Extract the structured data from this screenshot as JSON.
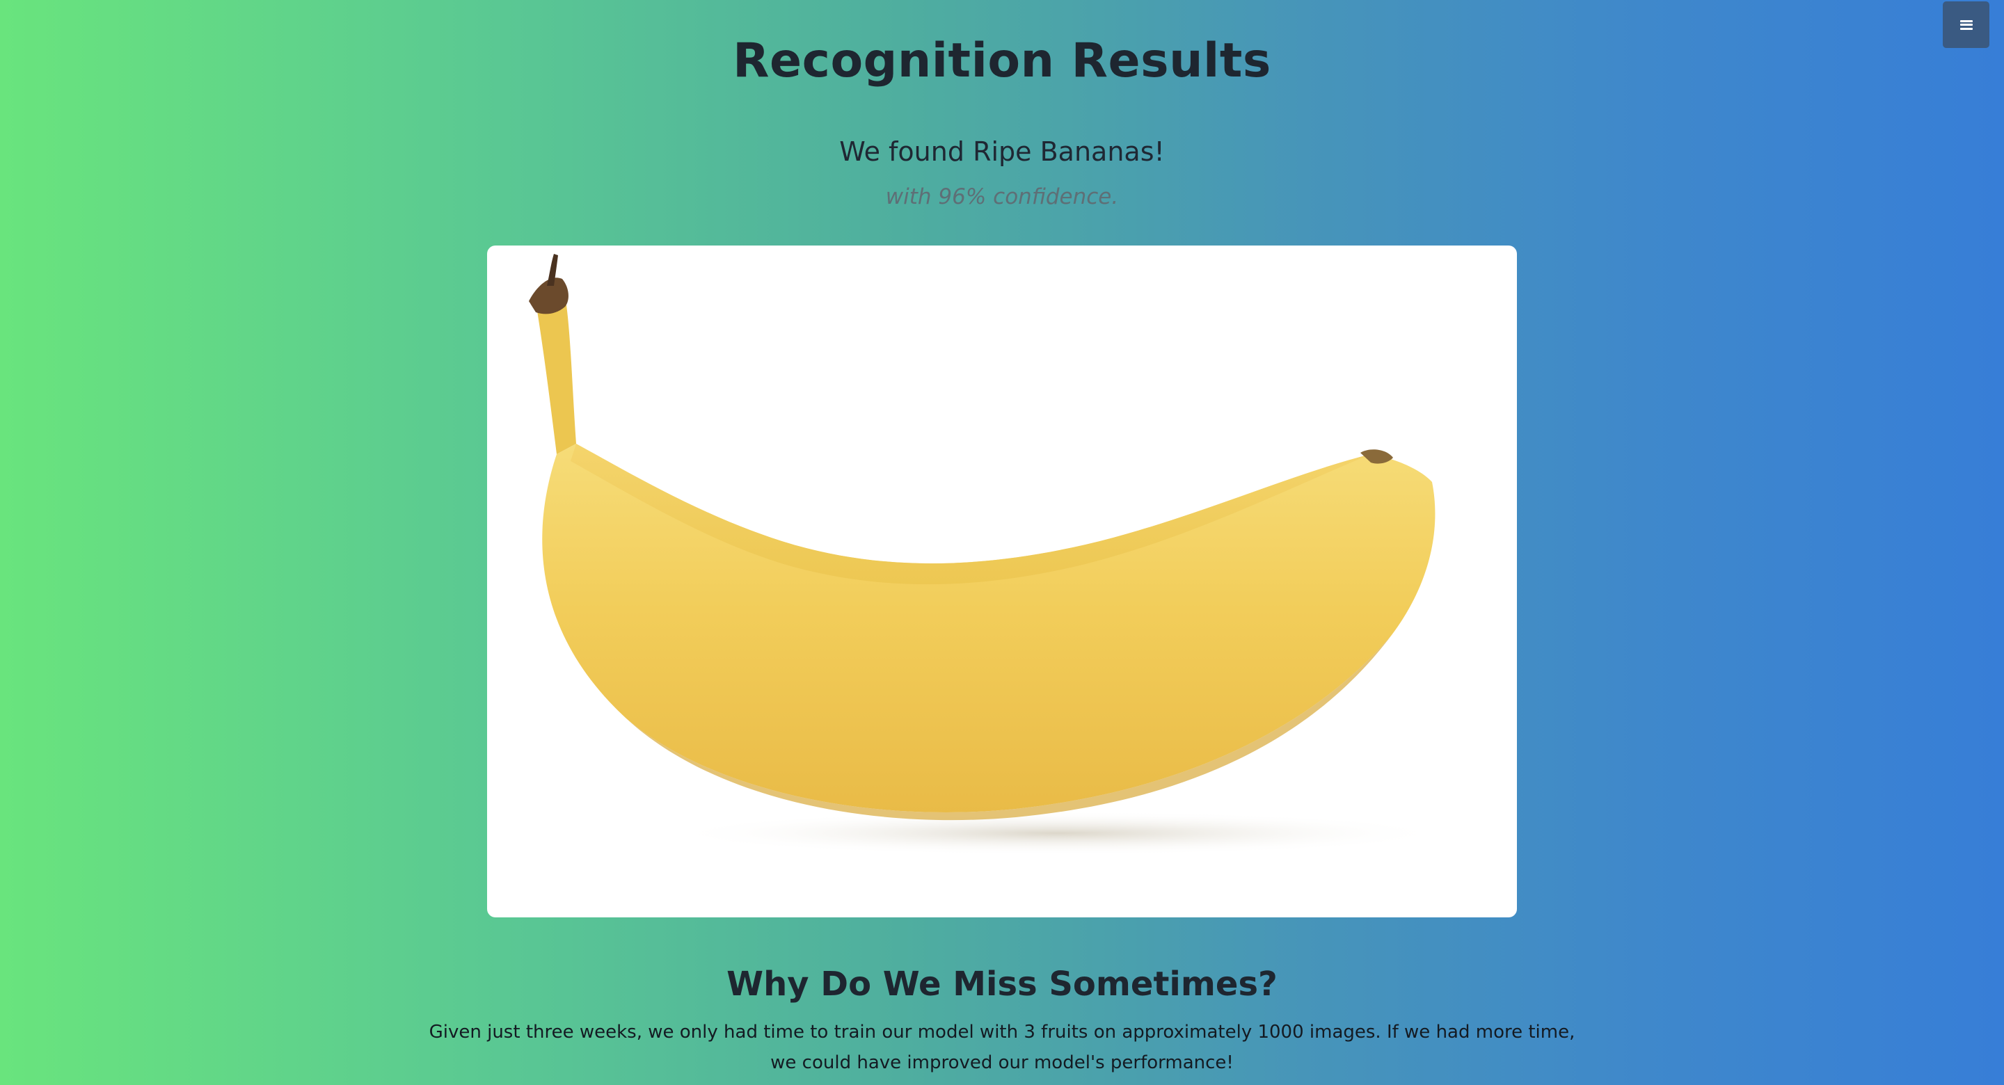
{
  "header": {
    "title": "Recognition Results"
  },
  "menu": {
    "icon": "menu-icon"
  },
  "result": {
    "prefix": "We found ",
    "fruit": "Ripe Bananas!",
    "confidence_text": "with 96% confidence.",
    "confidence_percent": 96,
    "image_subject": "banana"
  },
  "explanation": {
    "heading": "Why Do We Miss Sometimes?",
    "body": "Given just three weeks, we only had time to train our model with 3 fruits on approximately 1000 images. If we had more time, we could have improved our model's performance!"
  },
  "colors": {
    "gradient_start": "#69e47d",
    "gradient_end": "#377ed7",
    "menu_button": "#3a5a82",
    "banana": "#f1cc57"
  }
}
